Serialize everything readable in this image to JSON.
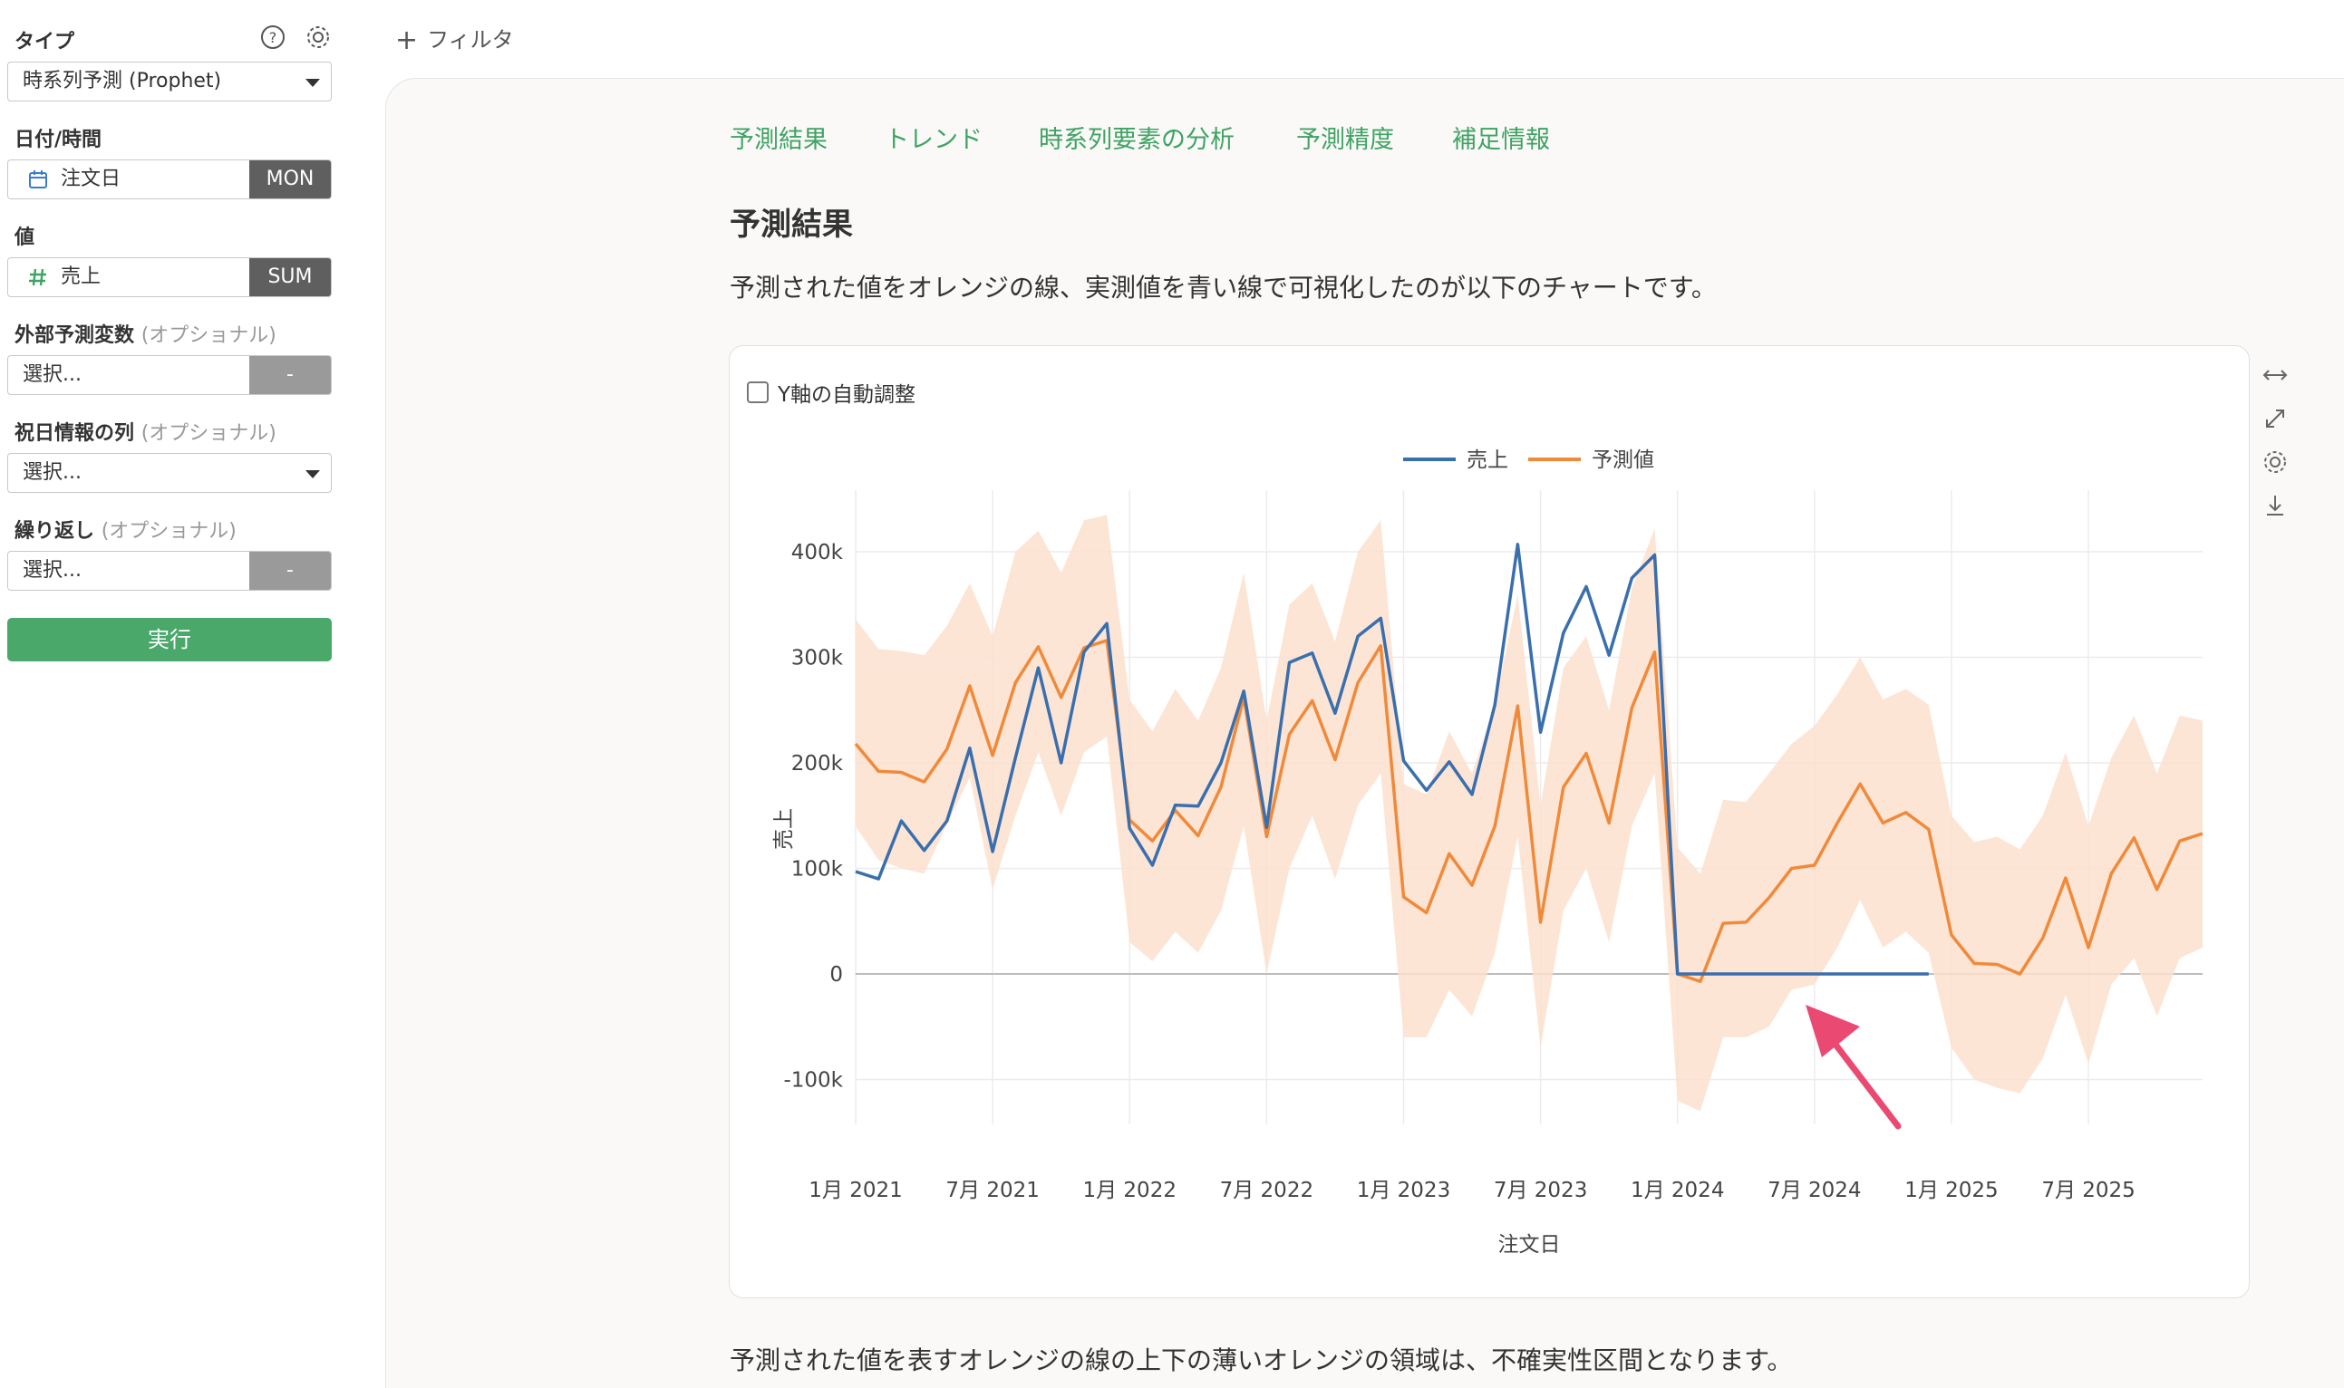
{
  "sidebar": {
    "type_label": "タイプ",
    "type_value": "時系列予測 (Prophet)",
    "date_label": "日付/時間",
    "date_field": "注文日",
    "date_tag": "MON",
    "value_label": "値",
    "value_field": "売上",
    "value_tag": "SUM",
    "external_label": "外部予測変数",
    "external_opt": "(オプショナル)",
    "external_placeholder": "選択...",
    "external_tag": "-",
    "holiday_label": "祝日情報の列",
    "holiday_opt": "(オプショナル)",
    "holiday_placeholder": "選択...",
    "repeat_label": "繰り返し",
    "repeat_opt": "(オプショナル)",
    "repeat_placeholder": "選択...",
    "repeat_tag": "-",
    "run_label": "実行",
    "icons": [
      "help-icon",
      "gear-icon",
      "calendar-icon",
      "hash-icon",
      "caret-down-icon"
    ]
  },
  "toolbar": {
    "filter_label": "フィルタ"
  },
  "tabs": [
    {
      "label": "予測結果"
    },
    {
      "label": "トレンド"
    },
    {
      "label": "時系列要素の分析"
    },
    {
      "label": "予測精度"
    },
    {
      "label": "補足情報"
    }
  ],
  "main": {
    "section_title": "予測結果",
    "description": "予測された値をオレンジの線、実測値を青い線で可視化したのが以下のチャートです。",
    "footer_text": "予測された値を表すオレンジの線の上下の薄いオレンジの領域は、不確実性区間となります。",
    "y_auto_label": "Y軸の自動調整"
  },
  "colors": {
    "accent": "#4aa86b",
    "actual": "#3a6fad",
    "forecast": "#f08a3a",
    "band": "#fde1cf",
    "annotation": "#ea4a72"
  },
  "chart_data": {
    "type": "line",
    "xlabel": "注文日",
    "ylabel": "売上",
    "ylim": [
      -150000,
      450000
    ],
    "xlim": [
      "2021-01",
      "2025-12"
    ],
    "x_ticks": [
      "1月 2021",
      "7月 2021",
      "1月 2022",
      "7月 2022",
      "1月 2023",
      "7月 2023",
      "1月 2024",
      "7月 2024",
      "1月 2025",
      "7月 2025"
    ],
    "y_ticks": [
      "-100k",
      "0",
      "100k",
      "200k",
      "300k",
      "400k"
    ],
    "y_tick_values": [
      -100000,
      0,
      100000,
      200000,
      300000,
      400000
    ],
    "legend": [
      "売上",
      "予測値"
    ],
    "legend_position": "top",
    "grid": true,
    "annotation": "arrow pointing at zero-valued actuals in 2024",
    "series": [
      {
        "name": "売上",
        "x": [
          "2021-01",
          "2021-02",
          "2021-03",
          "2021-04",
          "2021-05",
          "2021-06",
          "2021-07",
          "2021-08",
          "2021-09",
          "2021-10",
          "2021-11",
          "2021-12",
          "2022-01",
          "2022-02",
          "2022-03",
          "2022-04",
          "2022-05",
          "2022-06",
          "2022-07",
          "2022-08",
          "2022-09",
          "2022-10",
          "2022-11",
          "2022-12",
          "2023-01",
          "2023-02",
          "2023-03",
          "2023-04",
          "2023-05",
          "2023-06",
          "2023-07",
          "2023-08",
          "2023-09",
          "2023-10",
          "2023-11",
          "2023-12",
          "2024-01",
          "2024-02",
          "2024-03",
          "2024-04",
          "2024-05",
          "2024-06",
          "2024-07",
          "2024-08",
          "2024-09",
          "2024-10",
          "2024-11",
          "2024-12"
        ],
        "values": [
          97000,
          90000,
          145000,
          117000,
          145000,
          214000,
          116000,
          205000,
          290000,
          200000,
          305000,
          332000,
          138000,
          103000,
          160000,
          159000,
          200000,
          268000,
          139000,
          295000,
          304000,
          247000,
          320000,
          337000,
          202000,
          174000,
          201000,
          170000,
          255000,
          407000,
          229000,
          323000,
          367000,
          302000,
          375000,
          397000,
          0,
          0,
          0,
          0,
          0,
          0,
          0,
          0,
          0,
          0,
          0,
          0
        ]
      },
      {
        "name": "予測値",
        "x": [
          "2021-01",
          "2021-02",
          "2021-03",
          "2021-04",
          "2021-05",
          "2021-06",
          "2021-07",
          "2021-08",
          "2021-09",
          "2021-10",
          "2021-11",
          "2021-12",
          "2022-01",
          "2022-02",
          "2022-03",
          "2022-04",
          "2022-05",
          "2022-06",
          "2022-07",
          "2022-08",
          "2022-09",
          "2022-10",
          "2022-11",
          "2022-12",
          "2023-01",
          "2023-02",
          "2023-03",
          "2023-04",
          "2023-05",
          "2023-06",
          "2023-07",
          "2023-08",
          "2023-09",
          "2023-10",
          "2023-11",
          "2023-12",
          "2024-01",
          "2024-02",
          "2024-03",
          "2024-04",
          "2024-05",
          "2024-06",
          "2024-07",
          "2024-08",
          "2024-09",
          "2024-10",
          "2024-11",
          "2024-12",
          "2025-01",
          "2025-02",
          "2025-03",
          "2025-04",
          "2025-05",
          "2025-06",
          "2025-07",
          "2025-08",
          "2025-09",
          "2025-10",
          "2025-11",
          "2025-12"
        ],
        "values": [
          218000,
          192000,
          191000,
          182000,
          213000,
          273000,
          207000,
          276000,
          310000,
          262000,
          309000,
          316000,
          146000,
          126000,
          155000,
          131000,
          177000,
          262000,
          130000,
          227000,
          259000,
          203000,
          276000,
          311000,
          73000,
          58000,
          114000,
          84000,
          140000,
          254000,
          49000,
          177000,
          209000,
          143000,
          252000,
          305000,
          0,
          -7000,
          48000,
          49000,
          72000,
          100000,
          103000,
          143000,
          180000,
          143000,
          153000,
          137000,
          37000,
          10000,
          9000,
          0,
          34000,
          91000,
          25000,
          95000,
          129000,
          80000,
          126000,
          133000
        ],
        "lower": [
          140000,
          108000,
          100000,
          95000,
          142000,
          186000,
          80000,
          150000,
          210000,
          150000,
          210000,
          225000,
          30000,
          12000,
          40000,
          20000,
          60000,
          140000,
          0,
          100000,
          150000,
          90000,
          160000,
          190000,
          -60000,
          -60000,
          -15000,
          -40000,
          20000,
          130000,
          -70000,
          60000,
          100000,
          30000,
          140000,
          190000,
          -120000,
          -130000,
          -60000,
          -60000,
          -50000,
          -15000,
          -10000,
          25000,
          70000,
          25000,
          40000,
          20000,
          -70000,
          -100000,
          -108000,
          -113000,
          -80000,
          -20000,
          -85000,
          -10000,
          15000,
          -40000,
          15000,
          25000
        ],
        "upper": [
          336000,
          308000,
          306000,
          302000,
          330000,
          370000,
          320000,
          400000,
          420000,
          380000,
          430000,
          435000,
          260000,
          230000,
          270000,
          240000,
          290000,
          380000,
          240000,
          350000,
          370000,
          315000,
          400000,
          430000,
          180000,
          170000,
          230000,
          190000,
          255000,
          360000,
          160000,
          290000,
          320000,
          250000,
          365000,
          422000,
          120000,
          95000,
          165000,
          163000,
          190000,
          218000,
          235000,
          265000,
          300000,
          260000,
          270000,
          255000,
          150000,
          125000,
          130000,
          118000,
          150000,
          210000,
          140000,
          205000,
          245000,
          190000,
          245000,
          240000
        ]
      }
    ]
  }
}
